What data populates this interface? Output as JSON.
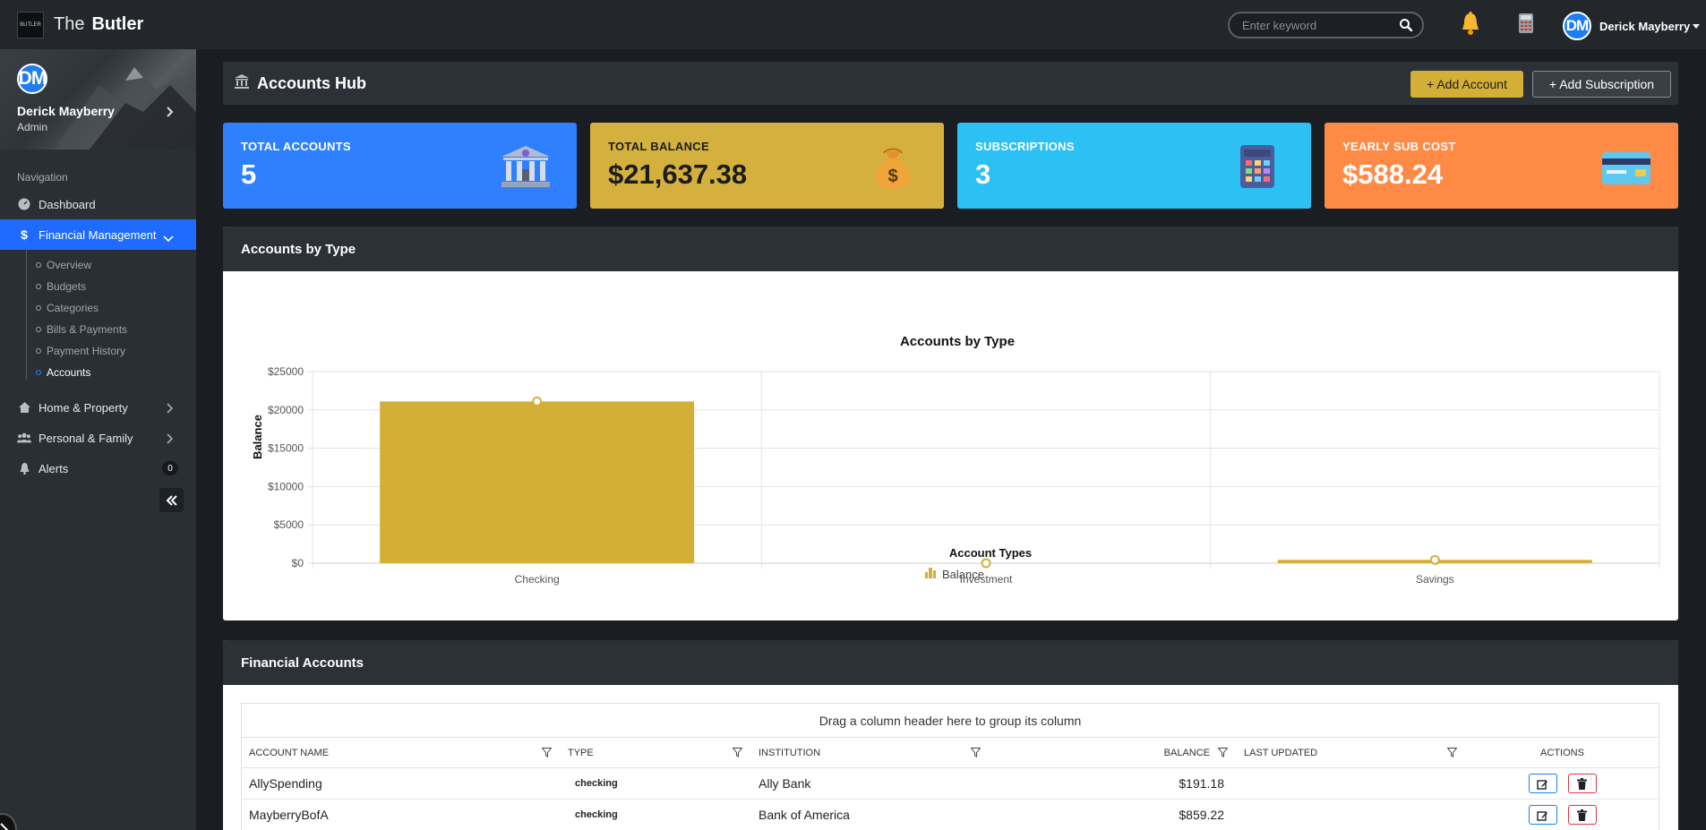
{
  "app": {
    "brand_prefix": "The",
    "brand_name": "Butler",
    "logo_text": "BUTLER"
  },
  "topbar": {
    "search_placeholder": "Enter keyword",
    "user_initials": "DM",
    "user_name": "Derick Mayberry"
  },
  "sidebar": {
    "profile_initials": "DM",
    "profile_name": "Derick Mayberry",
    "profile_role": "Admin",
    "nav_heading": "Navigation",
    "items": {
      "dashboard": "Dashboard",
      "financial": "Financial Management",
      "home": "Home & Property",
      "personal": "Personal & Family",
      "alerts": "Alerts",
      "alerts_count": "0"
    },
    "financial_sub": [
      "Overview",
      "Budgets",
      "Categories",
      "Bills & Payments",
      "Payment History",
      "Accounts"
    ]
  },
  "page": {
    "title": "Accounts Hub",
    "add_account": "+ Add Account",
    "add_subscription": "+ Add Subscription"
  },
  "stats": [
    {
      "label": "TOTAL ACCOUNTS",
      "value": "5",
      "color": "#2f80ff",
      "icon": "bank-icon"
    },
    {
      "label": "TOTAL BALANCE",
      "value": "$21,637.38",
      "color": "#d4b13f",
      "icon": "money-bag-icon"
    },
    {
      "label": "SUBSCRIPTIONS",
      "value": "3",
      "color": "#2cc0f5",
      "icon": "calculator-icon"
    },
    {
      "label": "YEARLY SUB COST",
      "value": "$588.24",
      "color": "#ff8a46",
      "icon": "credit-card-icon"
    }
  ],
  "chart_card": {
    "header": "Accounts by Type"
  },
  "chart_data": {
    "type": "bar",
    "title": "Accounts by Type",
    "xlabel": "Account Types",
    "ylabel": "Balance",
    "categories": [
      "Checking",
      "Investment",
      "Savings"
    ],
    "series": [
      {
        "name": "Balance",
        "values": [
          21100,
          0,
          430
        ]
      }
    ],
    "ylim": [
      0,
      25000
    ],
    "yticks": [
      "$0",
      "$5000",
      "$10000",
      "$15000",
      "$20000",
      "$25000"
    ],
    "bar_color": "#d4af37",
    "grid": true,
    "legend": "bottom-center"
  },
  "table_card": {
    "header": "Financial Accounts",
    "group_hint": "Drag a column header here to group its column",
    "columns": [
      "ACCOUNT NAME",
      "TYPE",
      "INSTITUTION",
      "BALANCE",
      "LAST UPDATED",
      "ACTIONS"
    ],
    "rows": [
      {
        "name": "AllySpending",
        "type": "checking",
        "institution": "Ally Bank",
        "balance": "$191.18",
        "updated": ""
      },
      {
        "name": "MayberryBofA",
        "type": "checking",
        "institution": "Bank of America",
        "balance": "$859.22",
        "updated": ""
      }
    ]
  }
}
